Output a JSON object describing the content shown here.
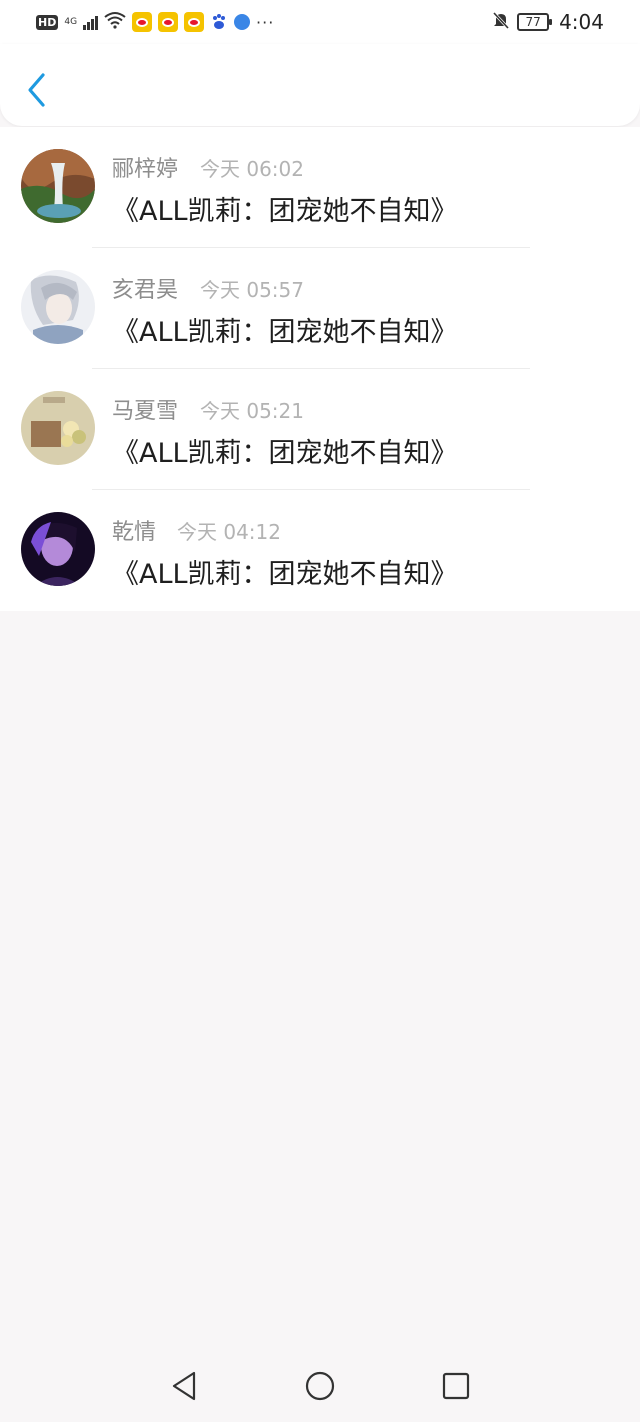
{
  "status_bar": {
    "hd": "HD",
    "network": "4G",
    "time": "4:04",
    "battery": "77",
    "more": "···"
  },
  "header": {
    "back_icon": "chevron-left-icon"
  },
  "colors": {
    "accent": "#1e9ae0",
    "name": "#8d8d8d",
    "time": "#b3b3b3",
    "text": "#1f1f1f"
  },
  "messages": [
    {
      "name": "郦梓婷",
      "time": "今天 06:02",
      "text": "《ALL凯莉：团宠她不自知》"
    },
    {
      "name": "亥君昊",
      "time": "今天 05:57",
      "text": "《ALL凯莉：团宠她不自知》"
    },
    {
      "name": "马夏雪",
      "time": "今天 05:21",
      "text": "《ALL凯莉：团宠她不自知》"
    },
    {
      "name": "乾情",
      "time": "今天 04:12",
      "text": "《ALL凯莉：团宠她不自知》"
    }
  ],
  "nav_bar": {
    "back": "triangle-back-icon",
    "home": "circle-home-icon",
    "recents": "square-recents-icon"
  }
}
